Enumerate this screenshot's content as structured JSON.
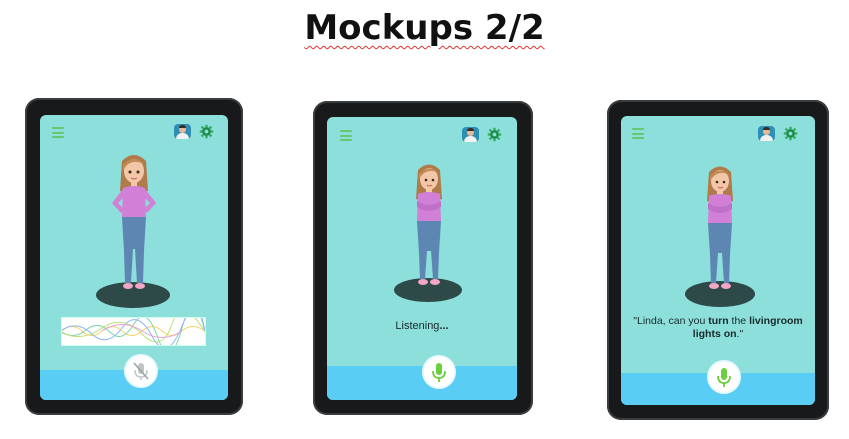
{
  "page": {
    "title": "Mockups 2/2"
  },
  "icons": {
    "menu": "hamburger-menu-icon",
    "avatar": "user-avatar",
    "settings": "gear-icon",
    "mic_muted": "microphone-muted-icon",
    "mic_active": "microphone-icon"
  },
  "colors": {
    "screen_bg": "#8cdfdb",
    "bottom_bar": "#59cdf3",
    "accent_green": "#63c96e",
    "platform": "#2d4a48",
    "tablet_frame": "#17191a"
  },
  "mockups": [
    {
      "state": "idle",
      "status_text": "",
      "mic": "muted"
    },
    {
      "state": "listening",
      "status_text": "Listening",
      "status_dots": "...",
      "mic": "active"
    },
    {
      "state": "response",
      "mic": "active",
      "quote": {
        "part1": "\"Linda, can you ",
        "bold1": "turn",
        "part2": " the ",
        "bold2": "livingroom lights on",
        "part3": ".\""
      }
    }
  ]
}
